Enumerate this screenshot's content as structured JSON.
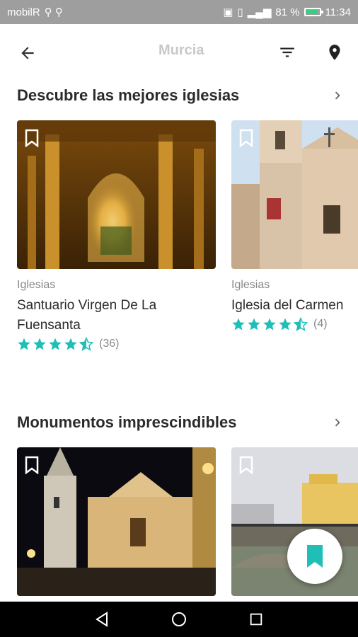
{
  "status_bar": {
    "carrier": "mobilR",
    "battery": "81 %",
    "time": "11:34"
  },
  "toolbar": {
    "title": "Murcia",
    "icons": [
      "back-arrow-icon",
      "filter-icon",
      "map-pin-icon"
    ]
  },
  "sections": [
    {
      "title": "Descubre las mejores iglesias",
      "cards": [
        {
          "category": "Iglesias",
          "title": "Santuario Virgen De La Fuensanta",
          "rating": 4.5,
          "reviews": "(36)"
        },
        {
          "category": "Iglesias",
          "title": "Iglesia del Carmen",
          "rating": 4.5,
          "reviews": "(4)"
        }
      ]
    },
    {
      "title": "Monumentos imprescindibles",
      "cards": [
        {
          "category": "",
          "title": ""
        },
        {
          "category": "",
          "title": ""
        }
      ]
    }
  ],
  "colors": {
    "accent": "#1fbfb8",
    "status_bar": "#9e9e9e",
    "text_primary": "#2b2b2b",
    "text_secondary": "#8a8a8a"
  }
}
